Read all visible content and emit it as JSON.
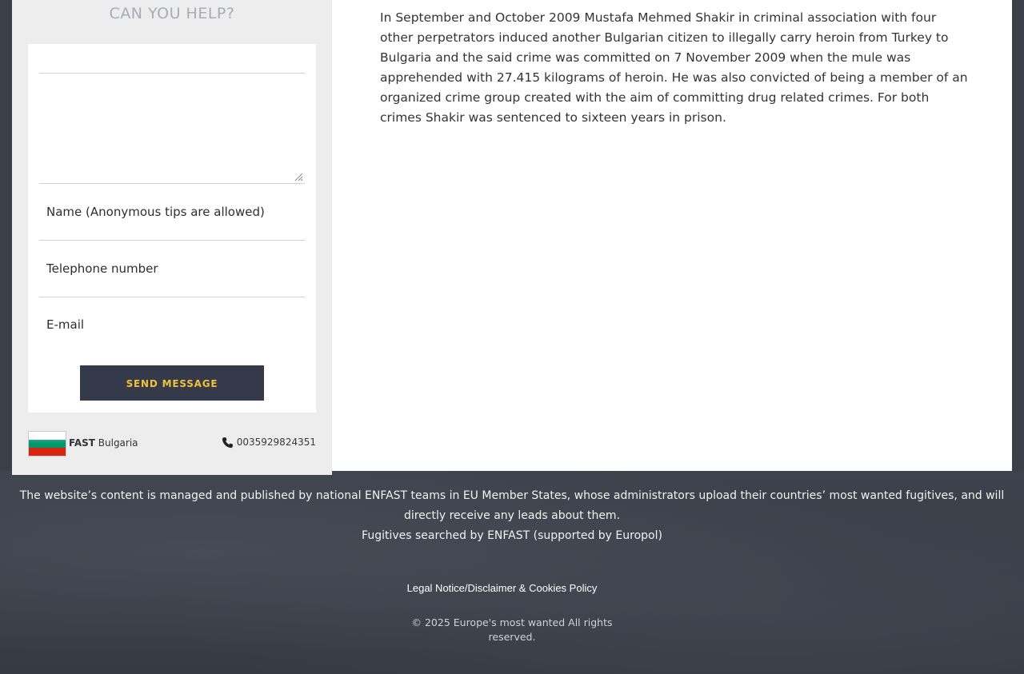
{
  "sidebar": {
    "title": "Can you help?",
    "form": {
      "name_placeholder": "Name (Anonymous tips are allowed)",
      "phone_placeholder": "Telephone number",
      "email_placeholder": "E-mail",
      "send_label": "Send message"
    },
    "team": {
      "prefix": "FAST",
      "country": "Bulgaria",
      "flag_colors": [
        "#ffffff",
        "#00966e",
        "#d62612"
      ],
      "phone": "0035929824351"
    }
  },
  "main": {
    "paragraph": "In September and October 2009 Mustafa Mehmed Shakir in criminal association with four other perpetrators induced another Bulgarian citizen to illegally carry heroin from Turkey to Bulgaria and the said crime was committed on 7 November 2009 when the mule was apprehended with 27.415 kilograms of heroin. He was also convicted of being a member of an organized crime group created with the aim of committing drug related crimes. For both crimes Shakir was sentenced to sixteen years in prison."
  },
  "footer": {
    "notice": "The website’s content is managed and published by national ENFAST teams in EU Member States, whose administrators upload their countries’ most wanted fugitives, and will directly receive any leads about them.",
    "supported": "Fugitives searched by ENFAST (supported by Europol)",
    "legal_link": "Legal Notice/Disclaimer & Cookies Policy",
    "copyright": "© 2025 Europe's most wanted All rights reserved."
  },
  "colors": {
    "button_bg": "#343a4a",
    "button_text": "#f2c13a",
    "title_text": "#a7acb6"
  }
}
